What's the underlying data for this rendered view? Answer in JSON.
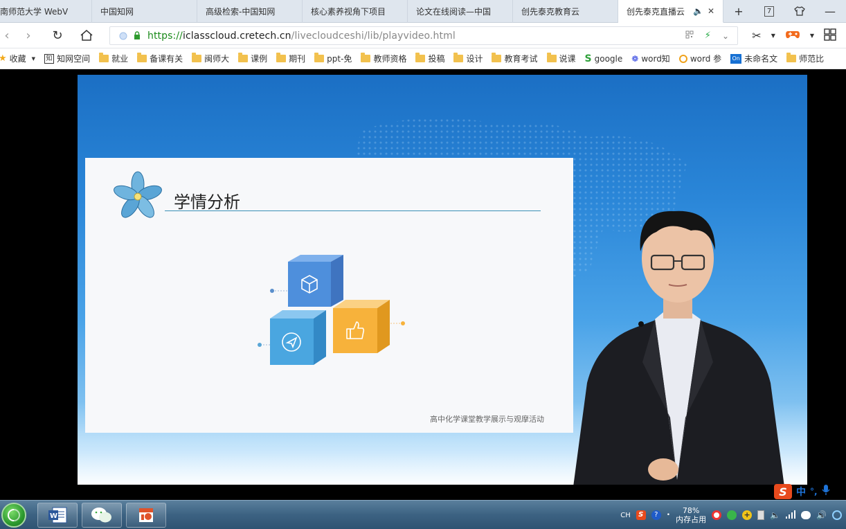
{
  "browser": {
    "tabs": [
      {
        "label": "南师范大学 WebV"
      },
      {
        "label": "中国知网"
      },
      {
        "label": "高级检索-中国知网"
      },
      {
        "label": "核心素养视角下项目"
      },
      {
        "label": "论文在线阅读—中国"
      },
      {
        "label": "创先泰克教育云"
      },
      {
        "label": "创先泰克直播云",
        "active": true
      }
    ],
    "tab_counter": "7",
    "url": {
      "scheme": "https://",
      "host": "iclasscloud.cretech.cn",
      "path": "/livecloudceshi/lib/playvideo.html"
    },
    "bookmarks": [
      {
        "label": "收藏",
        "icon": "star-icon"
      },
      {
        "label": "知网空间",
        "icon": "cnki-icon"
      },
      {
        "label": "就业",
        "icon": "folder-icon"
      },
      {
        "label": "备课有关",
        "icon": "folder-icon"
      },
      {
        "label": "闽师大",
        "icon": "folder-icon"
      },
      {
        "label": "课例",
        "icon": "folder-icon"
      },
      {
        "label": "期刊",
        "icon": "folder-icon"
      },
      {
        "label": "ppt-免",
        "icon": "folder-icon"
      },
      {
        "label": "教师资格",
        "icon": "folder-icon"
      },
      {
        "label": "投稿",
        "icon": "folder-icon"
      },
      {
        "label": "设计",
        "icon": "folder-icon"
      },
      {
        "label": "教育考试",
        "icon": "folder-icon"
      },
      {
        "label": "说课",
        "icon": "folder-icon"
      },
      {
        "label": "google",
        "icon": "google-s-icon"
      },
      {
        "label": "word知",
        "icon": "baidu-paw-icon"
      },
      {
        "label": "word 参",
        "icon": "search-o-icon"
      },
      {
        "label": "未命名文",
        "icon": "onenote-icon"
      },
      {
        "label": "师范比",
        "icon": "folder-icon"
      }
    ]
  },
  "slide": {
    "title": "学情分析",
    "footer": "高中化学课堂教学展示与观摩活动",
    "icons": [
      "cube-icon",
      "paper-plane-icon",
      "thumbs-up-icon"
    ]
  },
  "taskbar": {
    "lang": "CH",
    "mem_percent": "78%",
    "mem_label": "内存占用",
    "ime_mode": "中",
    "ime_punct": "°,"
  },
  "colors": {
    "accent_blue": "#2a86d8",
    "cube_blue": "#4e8fdc",
    "cube_light_blue": "#4aa6e0",
    "cube_orange": "#f7b23b",
    "url_green": "#1a8a1a"
  }
}
